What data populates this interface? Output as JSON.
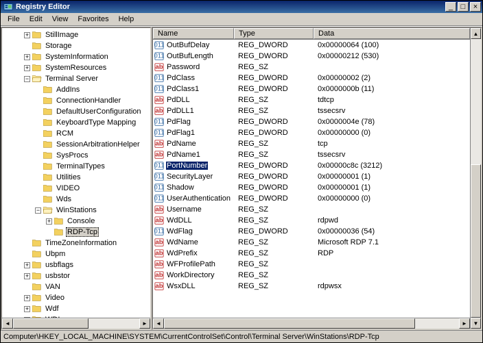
{
  "window": {
    "title": "Registry Editor",
    "btn_min": "_",
    "btn_max": "□",
    "btn_close": "×"
  },
  "menu": {
    "file": "File",
    "edit": "Edit",
    "view": "View",
    "favorites": "Favorites",
    "help": "Help"
  },
  "tree": [
    {
      "depth": 2,
      "exp": "+",
      "label": "StillImage"
    },
    {
      "depth": 2,
      "exp": "",
      "label": "Storage"
    },
    {
      "depth": 2,
      "exp": "+",
      "label": "SystemInformation"
    },
    {
      "depth": 2,
      "exp": "+",
      "label": "SystemResources"
    },
    {
      "depth": 2,
      "exp": "-",
      "label": "Terminal Server"
    },
    {
      "depth": 3,
      "exp": "",
      "label": "AddIns"
    },
    {
      "depth": 3,
      "exp": "",
      "label": "ConnectionHandler"
    },
    {
      "depth": 3,
      "exp": "",
      "label": "DefaultUserConfiguration"
    },
    {
      "depth": 3,
      "exp": "",
      "label": "KeyboardType Mapping"
    },
    {
      "depth": 3,
      "exp": "",
      "label": "RCM"
    },
    {
      "depth": 3,
      "exp": "",
      "label": "SessionArbitrationHelper"
    },
    {
      "depth": 3,
      "exp": "",
      "label": "SysProcs"
    },
    {
      "depth": 3,
      "exp": "",
      "label": "TerminalTypes"
    },
    {
      "depth": 3,
      "exp": "",
      "label": "Utilities"
    },
    {
      "depth": 3,
      "exp": "",
      "label": "VIDEO"
    },
    {
      "depth": 3,
      "exp": "",
      "label": "Wds"
    },
    {
      "depth": 3,
      "exp": "-",
      "label": "WinStations"
    },
    {
      "depth": 4,
      "exp": "+",
      "label": "Console"
    },
    {
      "depth": 4,
      "exp": "",
      "label": "RDP-Tcp",
      "selected": true
    },
    {
      "depth": 2,
      "exp": "",
      "label": "TimeZoneInformation"
    },
    {
      "depth": 2,
      "exp": "",
      "label": "Ubpm"
    },
    {
      "depth": 2,
      "exp": "+",
      "label": "usbflags"
    },
    {
      "depth": 2,
      "exp": "+",
      "label": "usbstor"
    },
    {
      "depth": 2,
      "exp": "",
      "label": "VAN"
    },
    {
      "depth": 2,
      "exp": "+",
      "label": "Video"
    },
    {
      "depth": 2,
      "exp": "+",
      "label": "Wdf"
    },
    {
      "depth": 2,
      "exp": "+",
      "label": "WDI"
    }
  ],
  "columns": {
    "name": "Name",
    "type": "Type",
    "data": "Data"
  },
  "rows": [
    {
      "icon": "dword",
      "name": "OutBufDelay",
      "type": "REG_DWORD",
      "data": "0x00000064 (100)"
    },
    {
      "icon": "dword",
      "name": "OutBufLength",
      "type": "REG_DWORD",
      "data": "0x00000212 (530)"
    },
    {
      "icon": "sz",
      "name": "Password",
      "type": "REG_SZ",
      "data": ""
    },
    {
      "icon": "dword",
      "name": "PdClass",
      "type": "REG_DWORD",
      "data": "0x00000002 (2)"
    },
    {
      "icon": "dword",
      "name": "PdClass1",
      "type": "REG_DWORD",
      "data": "0x0000000b (11)"
    },
    {
      "icon": "sz",
      "name": "PdDLL",
      "type": "REG_SZ",
      "data": "tdtcp"
    },
    {
      "icon": "sz",
      "name": "PdDLL1",
      "type": "REG_SZ",
      "data": "tssecsrv"
    },
    {
      "icon": "dword",
      "name": "PdFlag",
      "type": "REG_DWORD",
      "data": "0x0000004e (78)"
    },
    {
      "icon": "dword",
      "name": "PdFlag1",
      "type": "REG_DWORD",
      "data": "0x00000000 (0)"
    },
    {
      "icon": "sz",
      "name": "PdName",
      "type": "REG_SZ",
      "data": "tcp"
    },
    {
      "icon": "sz",
      "name": "PdName1",
      "type": "REG_SZ",
      "data": "tssecsrv"
    },
    {
      "icon": "dword",
      "name": "PortNumber",
      "type": "REG_DWORD",
      "data": "0x00000c8c (3212)",
      "selected": true
    },
    {
      "icon": "dword",
      "name": "SecurityLayer",
      "type": "REG_DWORD",
      "data": "0x00000001 (1)"
    },
    {
      "icon": "dword",
      "name": "Shadow",
      "type": "REG_DWORD",
      "data": "0x00000001 (1)"
    },
    {
      "icon": "dword",
      "name": "UserAuthentication",
      "type": "REG_DWORD",
      "data": "0x00000000 (0)"
    },
    {
      "icon": "sz",
      "name": "Username",
      "type": "REG_SZ",
      "data": ""
    },
    {
      "icon": "sz",
      "name": "WdDLL",
      "type": "REG_SZ",
      "data": "rdpwd"
    },
    {
      "icon": "dword",
      "name": "WdFlag",
      "type": "REG_DWORD",
      "data": "0x00000036 (54)"
    },
    {
      "icon": "sz",
      "name": "WdName",
      "type": "REG_SZ",
      "data": "Microsoft RDP 7.1"
    },
    {
      "icon": "sz",
      "name": "WdPrefix",
      "type": "REG_SZ",
      "data": "RDP"
    },
    {
      "icon": "sz",
      "name": "WFProfilePath",
      "type": "REG_SZ",
      "data": ""
    },
    {
      "icon": "sz",
      "name": "WorkDirectory",
      "type": "REG_SZ",
      "data": ""
    },
    {
      "icon": "sz",
      "name": "WsxDLL",
      "type": "REG_SZ",
      "data": "rdpwsx"
    }
  ],
  "status": "Computer\\HKEY_LOCAL_MACHINE\\SYSTEM\\CurrentControlSet\\Control\\Terminal Server\\WinStations\\RDP-Tcp"
}
